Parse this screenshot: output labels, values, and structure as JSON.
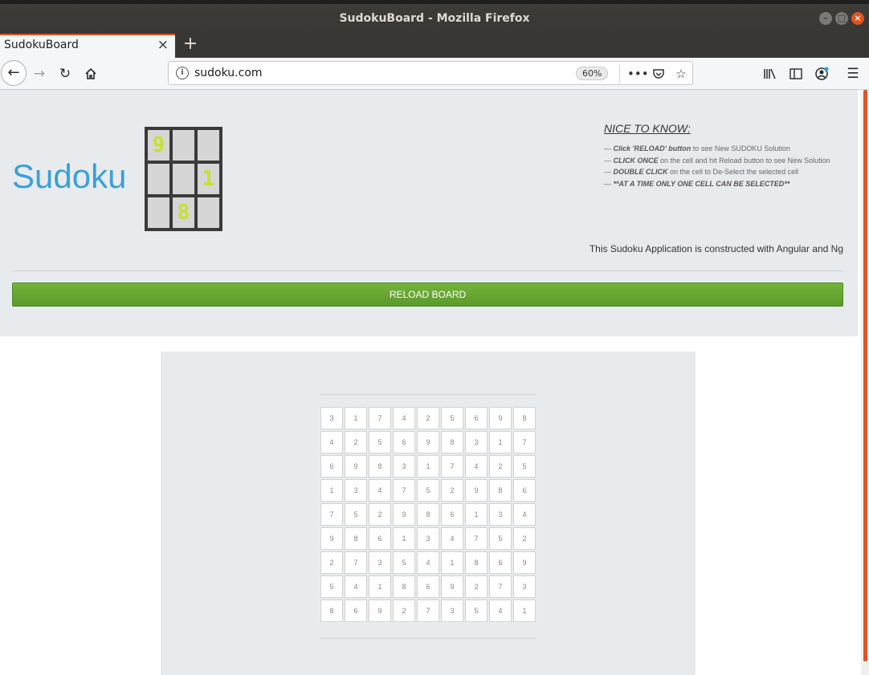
{
  "window": {
    "title": "SudokuBoard - Mozilla Firefox",
    "controls": {
      "minimize": "–",
      "maximize": "□",
      "close": "×"
    }
  },
  "tabs": [
    {
      "label": "SudokuBoard",
      "close": "×"
    }
  ],
  "new_tab_label": "+",
  "navbar": {
    "url": "sudoku.com",
    "zoom": "60%",
    "page_actions": "•••"
  },
  "header": {
    "brand": "Sudoku",
    "mini_board": [
      "9",
      "",
      "",
      "",
      "",
      "1",
      "",
      "8",
      ""
    ],
    "nice_title": "NICE TO KNOW:",
    "tips": [
      {
        "bold": "Click 'RELOAD' button",
        "rest": " to see New SUDOKU Solution"
      },
      {
        "bold": "CLICK ONCE",
        "rest": " on the cell and hit Reload button to see New Solution"
      },
      {
        "bold": "DOUBLE CLICK",
        "rest": " on the cell to De-Select the selected cell"
      },
      {
        "bold": "**AT A TIME ONLY ONE CELL CAN BE SELECTED**",
        "rest": ""
      }
    ],
    "tip_prefix": "— ",
    "built_note": "This Sudoku Application is constructed with Angular and Ng",
    "reload_label": "RELOAD BOARD"
  },
  "board": [
    [
      "3",
      "1",
      "7",
      "4",
      "2",
      "5",
      "6",
      "9",
      "8"
    ],
    [
      "4",
      "2",
      "5",
      "6",
      "9",
      "8",
      "3",
      "1",
      "7"
    ],
    [
      "6",
      "9",
      "8",
      "3",
      "1",
      "7",
      "4",
      "2",
      "5"
    ],
    [
      "1",
      "3",
      "4",
      "7",
      "5",
      "2",
      "9",
      "8",
      "6"
    ],
    [
      "7",
      "5",
      "2",
      "9",
      "8",
      "6",
      "1",
      "3",
      "4"
    ],
    [
      "9",
      "8",
      "6",
      "1",
      "3",
      "4",
      "7",
      "5",
      "2"
    ],
    [
      "2",
      "7",
      "3",
      "5",
      "4",
      "1",
      "8",
      "6",
      "9"
    ],
    [
      "5",
      "4",
      "1",
      "8",
      "6",
      "9",
      "2",
      "7",
      "3"
    ],
    [
      "8",
      "6",
      "9",
      "2",
      "7",
      "3",
      "5",
      "4",
      "1"
    ]
  ],
  "colors": {
    "brand": "#3aa0d9",
    "reload_button": "#67a533",
    "mini_digits": "#c9e02a",
    "tab_accent": "#e0541e"
  }
}
